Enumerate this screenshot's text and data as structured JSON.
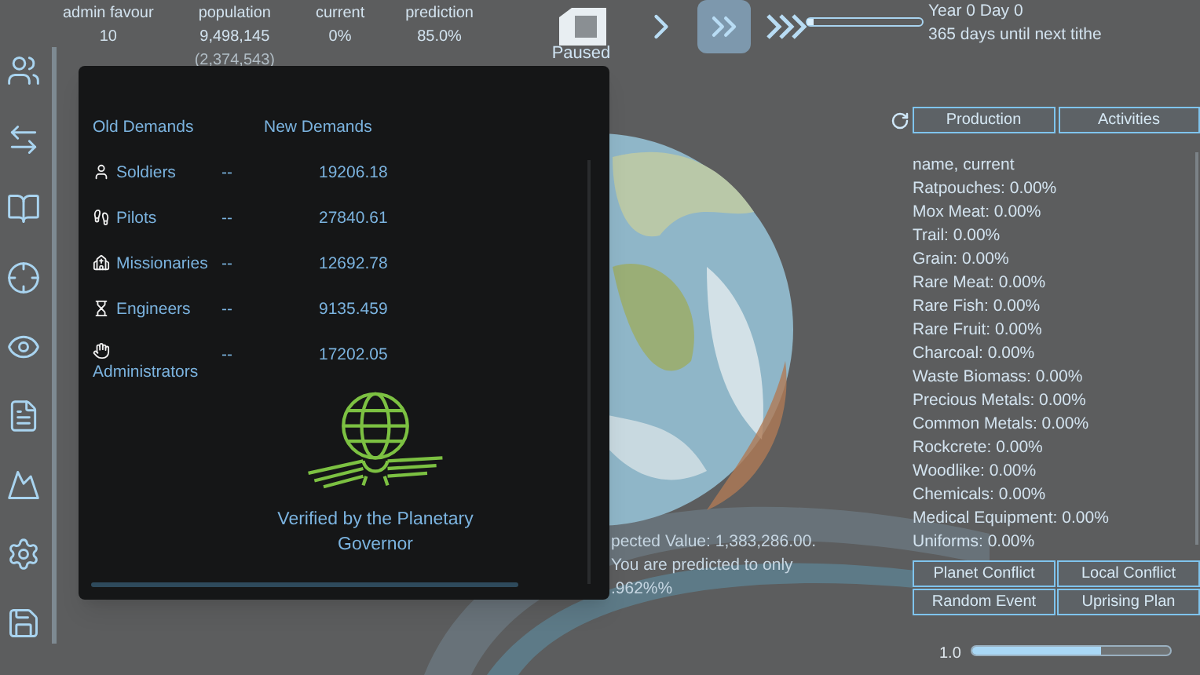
{
  "stats": [
    {
      "label": "admin favour",
      "value": "10"
    },
    {
      "label": "population",
      "value": "9,498,145",
      "sub": "(2,374,543)"
    },
    {
      "label": "current",
      "value": "0%"
    },
    {
      "label": "prediction",
      "value": "85.0%"
    }
  ],
  "speed": {
    "paused_label": "Paused",
    "buttons": [
      {
        "kind": "pause",
        "selected": false
      },
      {
        "kind": "normal",
        "selected": false
      },
      {
        "kind": "fast",
        "selected": true
      },
      {
        "kind": "fastest",
        "selected": false
      }
    ]
  },
  "time_slider": {
    "level": 0.05
  },
  "date": "Year 0 Day 0",
  "tithe": "365 days until next tithe",
  "demands": {
    "headers": [
      "Old Demands",
      "New Demands"
    ],
    "rows": [
      {
        "kind": "soldier",
        "name": "Soldiers",
        "old": "--",
        "new": "19206.18"
      },
      {
        "kind": "pilot",
        "name": "Pilots",
        "old": "--",
        "new": "27840.61"
      },
      {
        "kind": "missionary",
        "name": "Missionaries",
        "old": "--",
        "new": "12692.78"
      },
      {
        "kind": "engineer",
        "name": "Engineers",
        "old": "--",
        "new": "9135.459"
      },
      {
        "kind": "administrator",
        "name": "Administrators",
        "old": "--",
        "new": "17202.05"
      }
    ],
    "verified": "Verified by the Planetary Governor"
  },
  "forecast": [
    "pected Value: 1,383,286.00.",
    "You are predicted to only",
    ".962%%"
  ],
  "tabs": [
    "Production",
    "Activities"
  ],
  "production": {
    "header": "name, current",
    "items": [
      "Ratpouches: 0.00%",
      "Mox Meat: 0.00%",
      "Trail: 0.00%",
      "Grain: 0.00%",
      "Rare Meat: 0.00%",
      "Rare Fish: 0.00%",
      "Rare Fruit: 0.00%",
      "Charcoal: 0.00%",
      "Waste Biomass: 0.00%",
      "Precious Metals: 0.00%",
      "Common Metals: 0.00%",
      "Rockcrete: 0.00%",
      "Woodlike: 0.00%",
      "Chemicals: 0.00%",
      "Medical Equipment: 0.00%",
      "Uniforms: 0.00%"
    ]
  },
  "events": [
    "Planet Conflict",
    "Local Conflict",
    "Random Event",
    "Uprising Plan"
  ],
  "game_speed": {
    "reading": "1.0",
    "level": 0.65
  }
}
